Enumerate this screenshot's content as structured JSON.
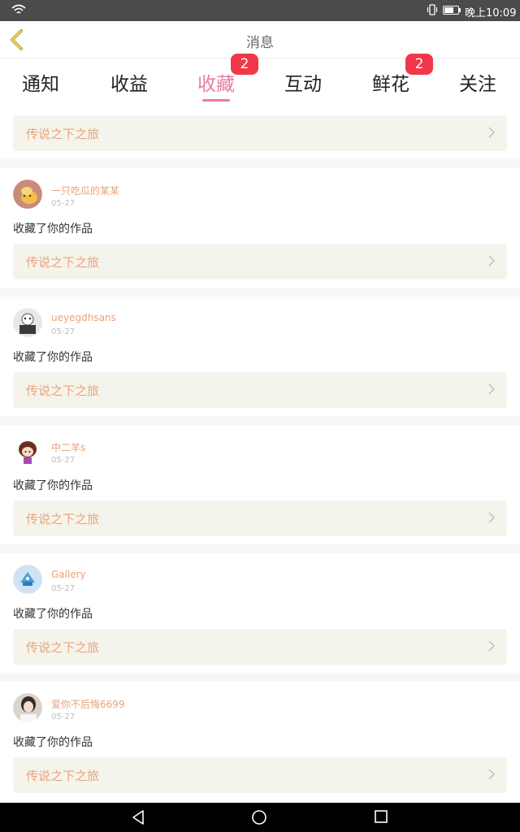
{
  "status_bar": {
    "time": "晚上10:09"
  },
  "header": {
    "title": "消息"
  },
  "tabs": [
    {
      "label": "通知",
      "badge": ""
    },
    {
      "label": "收益",
      "badge": ""
    },
    {
      "label": "收藏",
      "badge": "2",
      "active": true
    },
    {
      "label": "互动",
      "badge": ""
    },
    {
      "label": "鲜花",
      "badge": "2"
    },
    {
      "label": "关注",
      "badge": ""
    }
  ],
  "top_work": {
    "label": "传说之下之旅"
  },
  "items": [
    {
      "username": "一只吃瓜的某某",
      "date": "05-27",
      "action": "收藏了你的作品",
      "work": "传说之下之旅"
    },
    {
      "username": "ueyegdhsans",
      "date": "05-27",
      "action": "收藏了你的作品",
      "work": "传说之下之旅"
    },
    {
      "username": "中二羊s",
      "date": "05-27",
      "action": "收藏了你的作品",
      "work": "传说之下之旅"
    },
    {
      "username": "Gallery",
      "date": "05-27",
      "action": "收藏了你的作品",
      "work": "传说之下之旅"
    },
    {
      "username": "爱你不后悔6699",
      "date": "05-27",
      "action": "收藏了你的作品",
      "work": "传说之下之旅"
    }
  ],
  "colors": {
    "accent": "#e97aa6",
    "badge": "#f1374a",
    "link": "#e9a379",
    "card": "#f5f4ec"
  },
  "icons": [
    "wifi-icon",
    "vibrate-icon",
    "battery-icon",
    "back-chevron-icon",
    "chevron-right-icon",
    "back-triangle-icon",
    "home-circle-icon",
    "recents-square-icon"
  ]
}
